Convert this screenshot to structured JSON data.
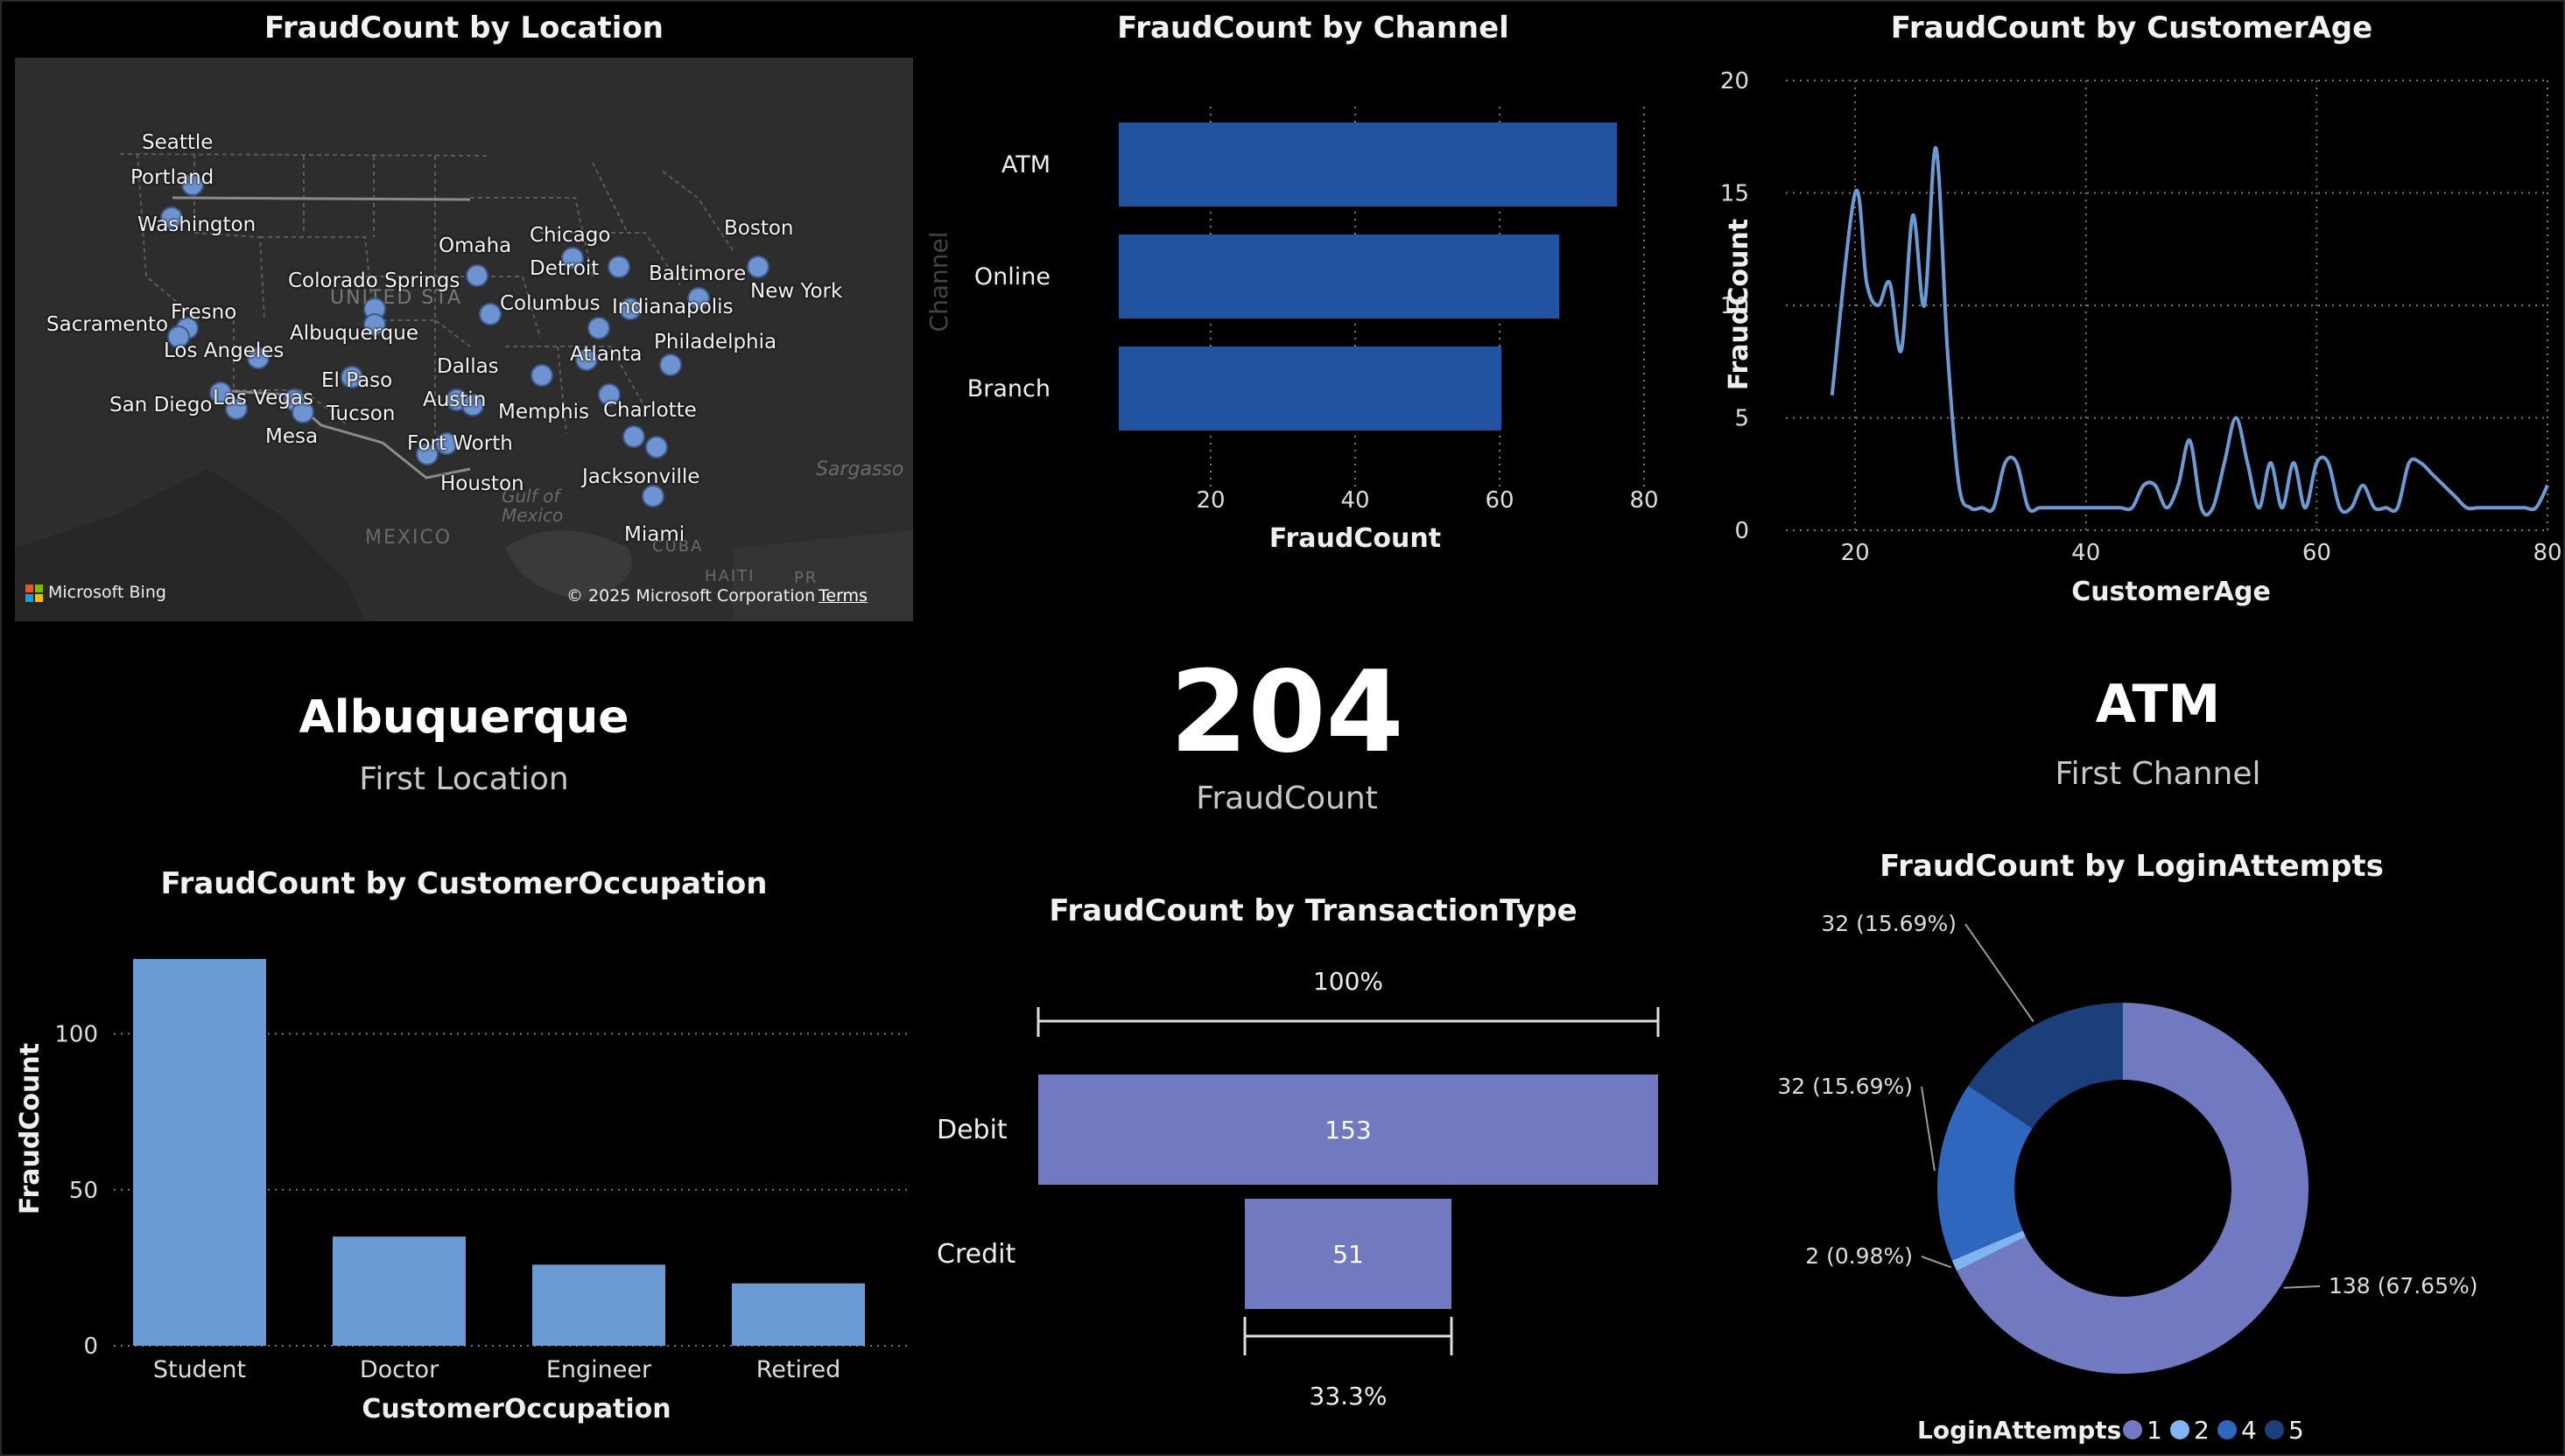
{
  "map": {
    "title": "FraudCount by Location",
    "cities": [
      {
        "name": "Seattle"
      },
      {
        "name": "Portland"
      },
      {
        "name": "Washington"
      },
      {
        "name": "Omaha"
      },
      {
        "name": "Chicago"
      },
      {
        "name": "Detroit"
      },
      {
        "name": "Boston"
      },
      {
        "name": "Baltimore"
      },
      {
        "name": "New York"
      },
      {
        "name": "Colorado Springs"
      },
      {
        "name": "Columbus"
      },
      {
        "name": "Indianapolis"
      },
      {
        "name": "Fresno"
      },
      {
        "name": "Sacramento"
      },
      {
        "name": "Los Angeles"
      },
      {
        "name": "Albuquerque"
      },
      {
        "name": "Philadelphia"
      },
      {
        "name": "Atlanta"
      },
      {
        "name": "El Paso"
      },
      {
        "name": "Dallas"
      },
      {
        "name": "Austin"
      },
      {
        "name": "Memphis"
      },
      {
        "name": "Charlotte"
      },
      {
        "name": "San Diego"
      },
      {
        "name": "Las Vegas"
      },
      {
        "name": "Tucson"
      },
      {
        "name": "Mesa"
      },
      {
        "name": "Fort Worth"
      },
      {
        "name": "Houston"
      },
      {
        "name": "Jacksonville"
      },
      {
        "name": "Miami"
      }
    ],
    "geo_labels": [
      "UNITED STA",
      "MEXICO",
      "Gulf of Mexico",
      "Sargasso",
      "CUBA",
      "HAITI",
      "PR"
    ],
    "bing_label": "Microsoft Bing",
    "copyright": "© 2025 Microsoft Corporation",
    "terms": "Terms"
  },
  "channel_chart": {
    "title": "FraudCount by Channel",
    "chart_data": {
      "type": "bar",
      "orientation": "horizontal",
      "categories": [
        "ATM",
        "Online",
        "Branch"
      ],
      "values": [
        76,
        68,
        60
      ],
      "xlabel": "FraudCount",
      "ylabel": "Channel",
      "xticks": [
        "20",
        "40",
        "60",
        "80"
      ],
      "xlim": [
        0,
        80
      ],
      "grid": true,
      "color": "#2153a0"
    }
  },
  "age_chart": {
    "title": "FraudCount by CustomerAge",
    "chart_data": {
      "type": "line",
      "x": [
        18,
        20,
        21,
        22,
        23,
        24,
        25,
        26,
        27,
        28,
        29,
        30,
        31,
        32,
        33,
        34,
        35,
        36,
        37,
        38,
        39,
        40,
        41,
        42,
        43,
        44,
        45,
        46,
        47,
        48,
        49,
        50,
        51,
        52,
        53,
        54,
        55,
        56,
        57,
        58,
        59,
        60,
        61,
        62,
        63,
        64,
        65,
        66,
        67,
        68,
        69,
        70,
        71,
        72,
        73,
        74,
        75,
        76,
        77,
        78,
        79,
        80
      ],
      "y": [
        6,
        15,
        11,
        10,
        11,
        8,
        14,
        10,
        17,
        8,
        2,
        1,
        1,
        1,
        3,
        3,
        1,
        1,
        1,
        1,
        1,
        1,
        1,
        1,
        1,
        1,
        2,
        2,
        1,
        2,
        4,
        1,
        1,
        3,
        5,
        3,
        1,
        3,
        1,
        3,
        1,
        3,
        3,
        1,
        1,
        2,
        1,
        1,
        1,
        3,
        3,
        2.5,
        2,
        1.5,
        1,
        1,
        1,
        1,
        1,
        1,
        1,
        2
      ],
      "xlabel": "CustomerAge",
      "ylabel": "FraudCount",
      "xticks": [
        "20",
        "40",
        "60",
        "80"
      ],
      "yticks": [
        "0",
        "5",
        "10",
        "15",
        "20"
      ],
      "xlim": [
        14,
        80
      ],
      "ylim": [
        0,
        20
      ],
      "grid": true,
      "color": "#6a9bd5"
    }
  },
  "first_location": {
    "value": "Albuquerque",
    "label": "First Location"
  },
  "fraud_count_card": {
    "value": "204",
    "label": "FraudCount"
  },
  "first_channel": {
    "value": "ATM",
    "label": "First Channel"
  },
  "occupation_chart": {
    "title": "FraudCount by CustomerOccupation",
    "chart_data": {
      "type": "bar",
      "categories": [
        "Student",
        "Doctor",
        "Engineer",
        "Retired"
      ],
      "values": [
        124,
        35,
        26,
        20
      ],
      "xlabel": "CustomerOccupation",
      "ylabel": "FraudCount",
      "yticks": [
        "0",
        "50",
        "100"
      ],
      "ylim": [
        0,
        124
      ],
      "grid": true,
      "color": "#6a9bd5"
    }
  },
  "transaction_chart": {
    "title": "FraudCount by TransactionType",
    "chart_data": {
      "type": "bar",
      "subtype": "funnel",
      "categories": [
        "Debit",
        "Credit"
      ],
      "values": [
        153,
        51
      ],
      "data_labels": [
        "153",
        "51"
      ],
      "top_percent": "100%",
      "bottom_percent": "33.3%",
      "color": "#7179c1"
    }
  },
  "login_chart": {
    "title": "FraudCount by LoginAttempts",
    "chart_data": {
      "type": "pie",
      "subtype": "donut",
      "categories": [
        "1",
        "2",
        "4",
        "5"
      ],
      "values": [
        138,
        2,
        32,
        32
      ],
      "data_labels": [
        "138 (67.65%)",
        "2 (0.98%)",
        "32 (15.69%)",
        "32 (15.69%)"
      ],
      "colors": [
        "#7179c1",
        "#81b5f1",
        "#2f67be",
        "#1b3f7b"
      ],
      "legend_title": "LoginAttempts",
      "legend_position": "bottom"
    }
  }
}
